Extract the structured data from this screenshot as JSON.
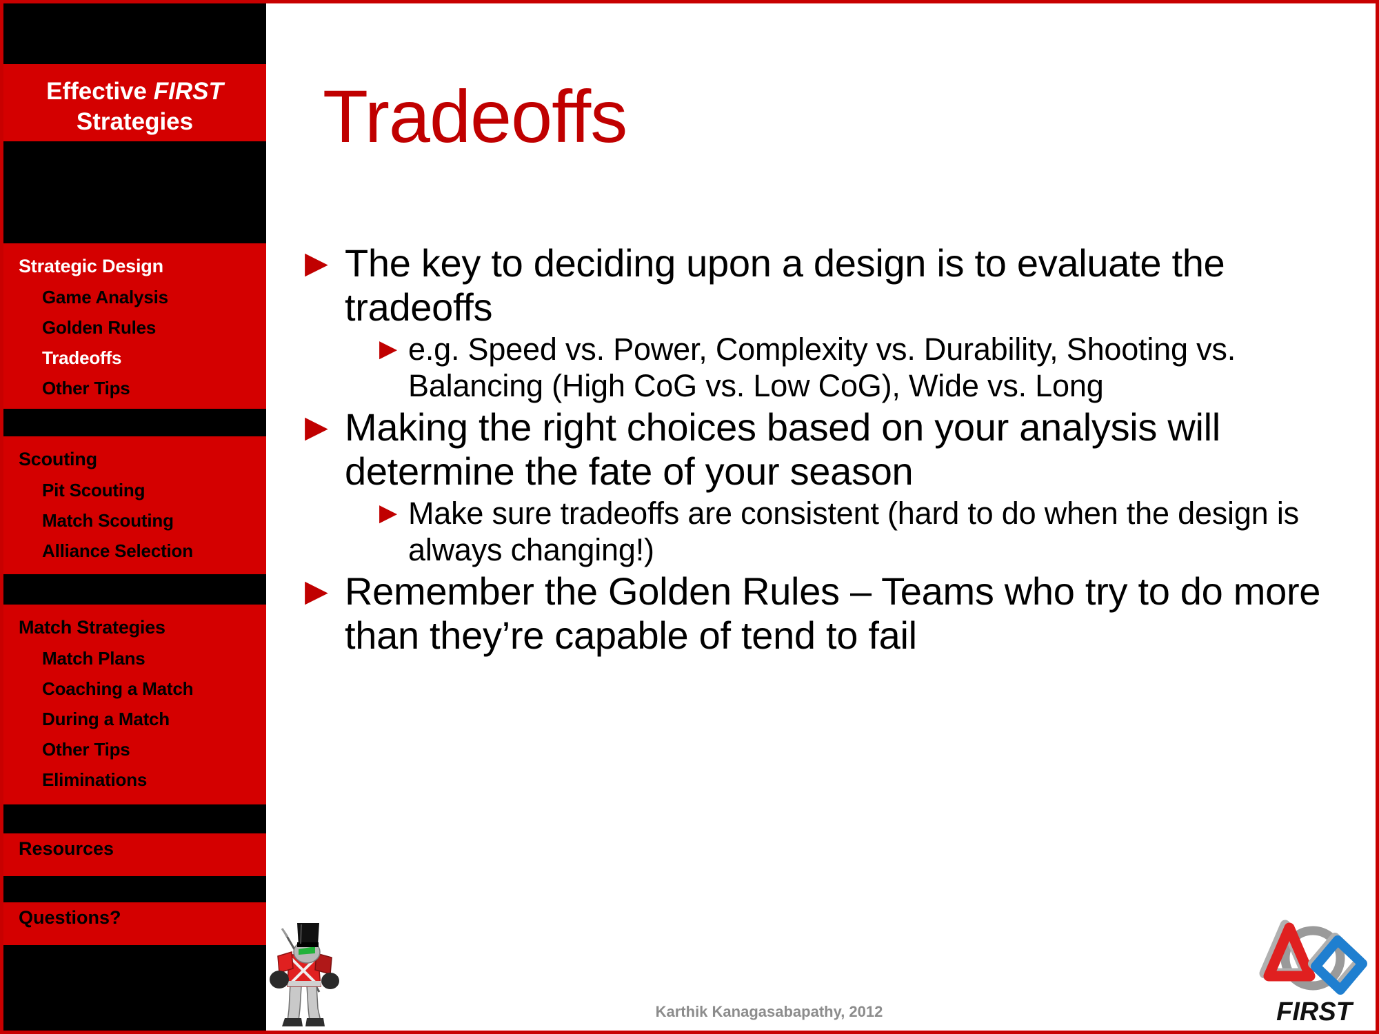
{
  "slide": {
    "title": "Tradeoffs",
    "accent_red": "#c00000",
    "sidebar_red": "#d40000",
    "sidebar_black": "#000000",
    "border_red": "#c80000"
  },
  "sidebar": {
    "brand_line1_normal": "Effective ",
    "brand_line1_italic": "FIRST",
    "brand_line2": "Strategies",
    "sections": [
      {
        "head": "Strategic Design",
        "head_active": true,
        "items": [
          {
            "label": "Game Analysis",
            "active": false
          },
          {
            "label": "Golden Rules",
            "active": false
          },
          {
            "label": "Tradeoffs",
            "active": true
          },
          {
            "label": "Other Tips",
            "active": false
          }
        ]
      },
      {
        "head": "Scouting",
        "head_active": false,
        "items": [
          {
            "label": "Pit Scouting",
            "active": false
          },
          {
            "label": "Match Scouting",
            "active": false
          },
          {
            "label": "Alliance Selection",
            "active": false
          }
        ]
      },
      {
        "head": "Match Strategies",
        "head_active": false,
        "items": [
          {
            "label": "Match Plans",
            "active": false
          },
          {
            "label": "Coaching a Match",
            "active": false
          },
          {
            "label": "During a Match",
            "active": false
          },
          {
            "label": "Other Tips",
            "active": false
          },
          {
            "label": "Eliminations",
            "active": false
          }
        ]
      }
    ],
    "standalone": [
      {
        "label": "Resources"
      },
      {
        "label": "Questions?"
      }
    ]
  },
  "content": {
    "bullet_marker": "▶",
    "bullets": [
      {
        "level": 1,
        "text": "The key to deciding upon a design is to evaluate the tradeoffs"
      },
      {
        "level": 2,
        "text": "e.g. Speed vs. Power, Complexity vs. Durability, Shooting vs. Balancing (High CoG vs. Low CoG), Wide vs. Long"
      },
      {
        "level": 1,
        "text": "Making the right choices based on your analysis will determine the fate of your season"
      },
      {
        "level": 2,
        "text": "Make sure tradeoffs are consistent (hard to do when the design is always changing!)"
      },
      {
        "level": 1,
        "text": "Remember the Golden Rules – Teams who try to do more than they’re capable of tend to fail"
      }
    ]
  },
  "footer": {
    "credit": "Karthik Kanagasabapathy, 2012"
  },
  "logo": {
    "wordmark": "FIRST",
    "triangle_color": "#e02020",
    "diamond_color": "#1f7fd0",
    "circle_color": "#9a9a9a"
  }
}
